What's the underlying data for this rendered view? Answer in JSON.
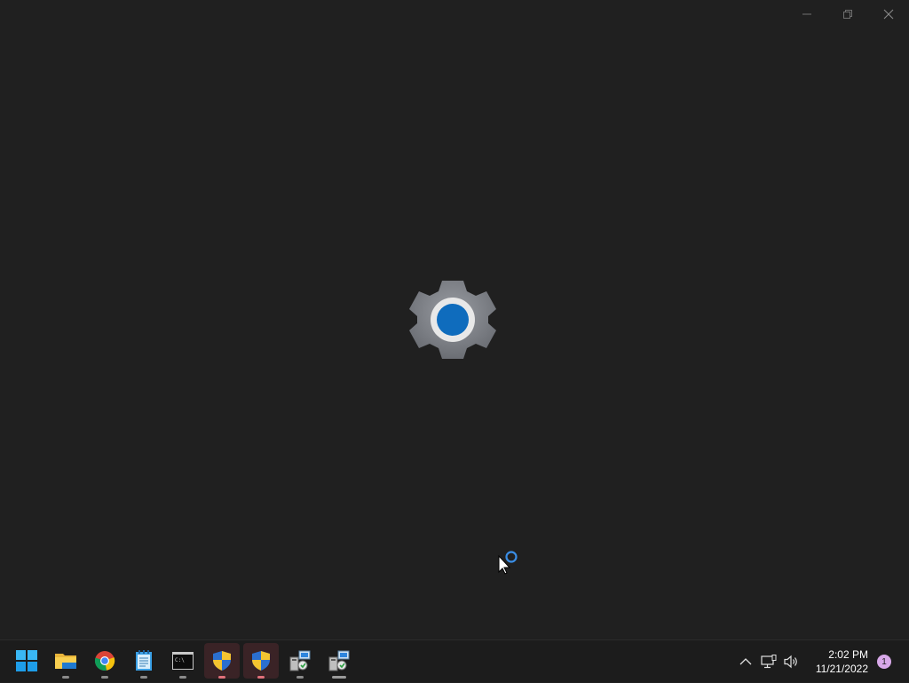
{
  "window": {
    "background": "#202020",
    "caption_buttons": [
      {
        "name": "minimize",
        "icon": "minimize-icon"
      },
      {
        "name": "restore",
        "icon": "restore-icon"
      },
      {
        "name": "close",
        "icon": "close-icon"
      }
    ],
    "splash_icon": "settings-gear-icon",
    "accent": "#0f6cbd"
  },
  "taskbar": {
    "apps": [
      {
        "name": "start",
        "icon": "windows-logo-icon",
        "running": false
      },
      {
        "name": "file-explorer",
        "icon": "folder-icon",
        "running": true
      },
      {
        "name": "chrome",
        "icon": "chrome-icon",
        "running": true
      },
      {
        "name": "notepad",
        "icon": "notepad-icon",
        "running": true
      },
      {
        "name": "command-prompt",
        "icon": "terminal-icon",
        "running": true
      },
      {
        "name": "uac-shield-1",
        "icon": "security-shield-icon",
        "running": true
      },
      {
        "name": "uac-shield-2",
        "icon": "security-shield-icon",
        "running": true
      },
      {
        "name": "installer-1",
        "icon": "installer-icon",
        "running": true
      },
      {
        "name": "installer-2",
        "icon": "installer-icon",
        "running": true
      }
    ],
    "tray": {
      "time": "2:02 PM",
      "date": "11/21/2022",
      "notification_count": "1"
    }
  }
}
